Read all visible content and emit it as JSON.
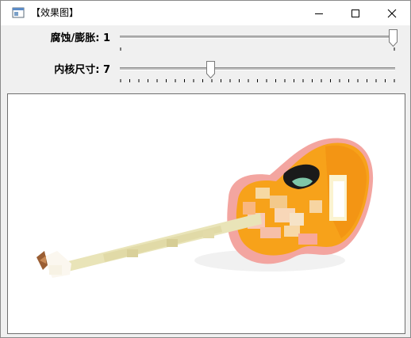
{
  "window": {
    "title": "【效果图】",
    "controls": {
      "minimize_icon": "minimize-icon",
      "maximize_icon": "maximize-icon",
      "close_icon": "close-icon"
    }
  },
  "trackbars": [
    {
      "label": "腐蚀/膨胀",
      "value": 1,
      "display": "腐蚀/膨胀: 1",
      "position_fraction": 1.0
    },
    {
      "label": "内核尺寸",
      "value": 7,
      "display": "内核尺寸: 7",
      "position_fraction": 0.33
    }
  ],
  "colors": {
    "guitar_orange": "#f7a21a",
    "guitar_pink": "#f3a5a0",
    "neck": "#e9e4b8"
  },
  "image": {
    "subject": "guitar",
    "background": "#ffffff"
  }
}
